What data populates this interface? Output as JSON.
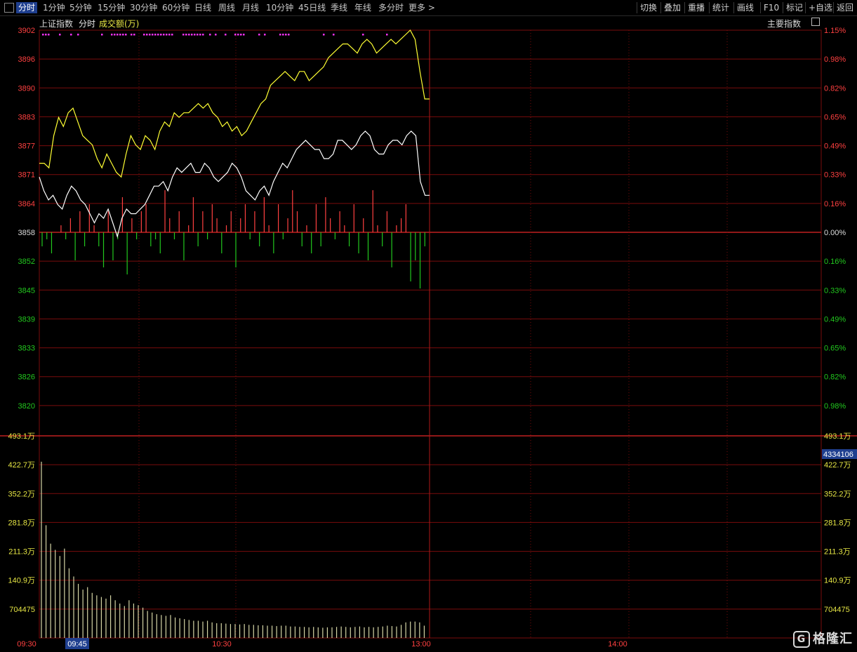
{
  "toolbar": {
    "left_items": [
      "分时",
      "1分钟",
      "5分钟",
      "15分钟",
      "30分钟",
      "60分钟",
      "日线",
      "周线",
      "月线",
      "10分钟",
      "45日线",
      "季线",
      "年线",
      "多分时",
      "更多 >"
    ],
    "active_index": 0,
    "right_items": [
      "切换",
      "叠加",
      "重播",
      "统计",
      "画线",
      "F10",
      "标记",
      "+自选",
      "返回"
    ]
  },
  "header": {
    "index_name": "上证指数",
    "mode": "分时",
    "volume_label": "成交额(万)",
    "right_button": "主要指数"
  },
  "colors": {
    "up": "#ff4040",
    "down": "#22c81e",
    "grid": "#7a0c0c",
    "price_line": "#ffffff",
    "avg_line": "#ffff33",
    "volume_bar": "#d6d6a6",
    "markers": "#ff33ff",
    "accent": "#1f3f8f"
  },
  "chart_data": {
    "type": "line",
    "price_axis": {
      "left_labels": [
        "3902",
        "3896",
        "3890",
        "3883",
        "3877",
        "3871",
        "3864",
        "3858",
        "3852",
        "3845",
        "3839",
        "3833",
        "3826",
        "3820"
      ],
      "right_labels": [
        "1.15%",
        "0.98%",
        "0.82%",
        "0.65%",
        "0.49%",
        "0.33%",
        "0.16%",
        "0.00%",
        "0.16%",
        "0.33%",
        "0.49%",
        "0.65%",
        "0.82%",
        "0.98%"
      ],
      "base": 3858,
      "ylim": [
        3820,
        3902
      ]
    },
    "volume_axis": {
      "labels": [
        "493.1万",
        "422.7万",
        "352.2万",
        "281.8万",
        "211.3万",
        "140.9万",
        "704475"
      ],
      "current_value": "4334106",
      "ylim": [
        0,
        493.1
      ]
    },
    "time_axis": {
      "labels": [
        "09:30",
        "09:45",
        "10:30",
        "13:00",
        "14:00"
      ],
      "highlight": "09:45"
    },
    "series": [
      {
        "line": "price",
        "values": [
          3870,
          3867,
          3865,
          3866,
          3864,
          3863,
          3866,
          3868,
          3867,
          3865,
          3864,
          3862,
          3860,
          3862,
          3861,
          3863,
          3860,
          3857,
          3861,
          3863,
          3862,
          3862,
          3863,
          3864,
          3866,
          3868,
          3868,
          3869,
          3867,
          3870,
          3872,
          3871,
          3872,
          3873,
          3871,
          3871,
          3873,
          3872,
          3870,
          3869,
          3870,
          3871,
          3873,
          3872,
          3870,
          3867,
          3866,
          3865,
          3867,
          3868,
          3866,
          3869,
          3871,
          3873,
          3872,
          3874,
          3876,
          3877,
          3878,
          3877,
          3876,
          3876,
          3874,
          3874,
          3875,
          3878,
          3878,
          3877,
          3876,
          3877,
          3879,
          3880,
          3879,
          3876,
          3875,
          3875,
          3877,
          3878,
          3878,
          3877,
          3879,
          3880,
          3879,
          3869,
          3866,
          3866
        ]
      },
      {
        "line": "average",
        "values": [
          3873,
          3873,
          3872,
          3879,
          3883,
          3881,
          3884,
          3885,
          3882,
          3879,
          3878,
          3877,
          3874,
          3872,
          3875,
          3873,
          3871,
          3870,
          3875,
          3879,
          3877,
          3876,
          3879,
          3878,
          3876,
          3880,
          3882,
          3881,
          3884,
          3883,
          3884,
          3884,
          3885,
          3886,
          3885,
          3886,
          3884,
          3883,
          3881,
          3882,
          3880,
          3881,
          3879,
          3880,
          3882,
          3884,
          3886,
          3887,
          3890,
          3891,
          3892,
          3893,
          3892,
          3891,
          3893,
          3893,
          3891,
          3892,
          3893,
          3894,
          3896,
          3897,
          3898,
          3899,
          3899,
          3898,
          3897,
          3899,
          3900,
          3899,
          3897,
          3898,
          3899,
          3900,
          3899,
          3900,
          3901,
          3902,
          3900,
          3893,
          3887,
          3887
        ]
      },
      {
        "line": "buy-sell-strength",
        "values": [
          -2,
          -1,
          -3,
          0,
          1,
          -1,
          2,
          -4,
          3,
          -2,
          4,
          1,
          -2,
          -5,
          3,
          -4,
          -1,
          5,
          -6,
          2,
          -1,
          3,
          4,
          -2,
          -1,
          -3,
          6,
          2,
          -1,
          3,
          -4,
          1,
          5,
          -2,
          3,
          -1,
          4,
          2,
          -3,
          1,
          3,
          -5,
          2,
          4,
          -1,
          3,
          -2,
          5,
          1,
          -3,
          4,
          -1,
          2,
          6,
          3,
          -2,
          1,
          -3,
          4,
          -2,
          5,
          2,
          -1,
          3,
          1,
          -2,
          4,
          -3,
          2,
          -4,
          6,
          1,
          -2,
          3,
          -5,
          1,
          2,
          4,
          -7,
          -4,
          -8,
          -2
        ]
      },
      {
        "line": "volume",
        "values": [
          430,
          275,
          230,
          215,
          200,
          218,
          170,
          150,
          132,
          118,
          124,
          110,
          104,
          100,
          96,
          104,
          92,
          84,
          78,
          92,
          84,
          80,
          74,
          66,
          62,
          58,
          56,
          54,
          56,
          50,
          48,
          46,
          44,
          42,
          42,
          40,
          42,
          38,
          36,
          36,
          35,
          34,
          34,
          33,
          34,
          32,
          32,
          31,
          31,
          30,
          30,
          29,
          30,
          30,
          28,
          28,
          27,
          27,
          26,
          27,
          26,
          25,
          26,
          26,
          27,
          28,
          27,
          26,
          27,
          28,
          26,
          27,
          26,
          27,
          28,
          30,
          29,
          28,
          32,
          38,
          40,
          40,
          38,
          30
        ]
      }
    ]
  },
  "watermark": "格隆汇"
}
